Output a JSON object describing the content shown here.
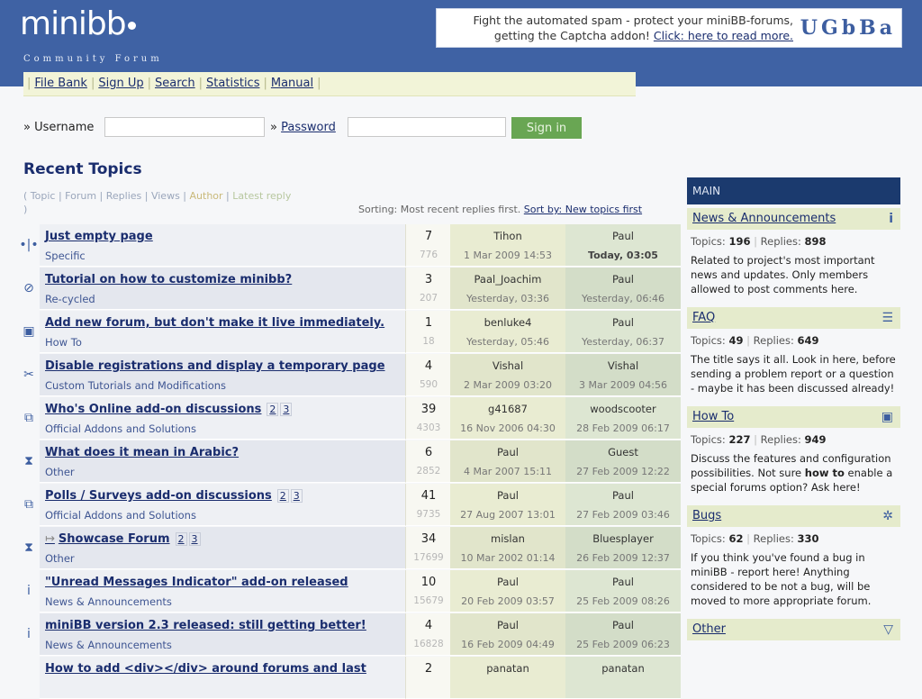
{
  "header": {
    "logo": "minibb",
    "logo_sub": "Community Forum",
    "ad_line1": "Fight the automated spam - protect your miniBB-forums,",
    "ad_line2": "getting the Captcha addon!",
    "ad_link": "Click: here to read more.",
    "ad_logo": "UGbBa"
  },
  "nav": [
    "File Bank",
    "Sign Up",
    "Search",
    "Statistics",
    "Manual"
  ],
  "login": {
    "username_label": "» Username",
    "password_label": "» Password",
    "signin": "Sign in"
  },
  "recent": {
    "title": "Recent Topics",
    "legend": [
      "Topic",
      "Forum",
      "Replies",
      "Views",
      "Author",
      "Latest reply"
    ],
    "sorting": "Sorting: Most recent replies first.",
    "sort_link": "Sort by: New topics first",
    "rows": [
      {
        "icon": "•|•",
        "title": "Just empty page",
        "forum": "Specific",
        "replies": "7",
        "views": "776",
        "author": "Tihon",
        "adate": "1 Mar 2009 14:53",
        "last": "Paul",
        "ldate": "Today, 03:05"
      },
      {
        "icon": "⊘",
        "title": "Tutorial on how to customize minibb?",
        "forum": "Re-cycled",
        "replies": "3",
        "views": "207",
        "author": "Paal_Joachim",
        "adate": "Yesterday, 03:36",
        "last": "Paul",
        "ldate": "Yesterday, 06:46"
      },
      {
        "icon": "▣",
        "title": "Add new forum, but don't make it live immediately.",
        "forum": "How To",
        "replies": "1",
        "views": "18",
        "author": "benluke4",
        "adate": "Yesterday, 05:46",
        "last": "Paul",
        "ldate": "Yesterday, 06:37"
      },
      {
        "icon": "✂",
        "title": "Disable registrations and display a temporary page",
        "forum": "Custom Tutorials and Modifications",
        "replies": "4",
        "views": "590",
        "author": "Vishal",
        "adate": "2 Mar 2009 03:20",
        "last": "Vishal",
        "ldate": "3 Mar 2009 04:56"
      },
      {
        "icon": "⧉",
        "title": "Who's Online add-on discussions",
        "pages": [
          "2",
          "3"
        ],
        "forum": "Official Addons and Solutions",
        "replies": "39",
        "views": "4303",
        "author": "g41687",
        "adate": "16 Nov 2006 04:30",
        "last": "woodscooter",
        "ldate": "28 Feb 2009 06:17"
      },
      {
        "icon": "⧗",
        "title": "What does it mean in Arabic?",
        "forum": "Other",
        "replies": "6",
        "views": "2852",
        "author": "Paul",
        "adate": "4 Mar 2007 15:11",
        "last": "Guest",
        "ldate": "27 Feb 2009 12:22"
      },
      {
        "icon": "⧉",
        "title": "Polls / Surveys add-on discussions",
        "pages": [
          "2",
          "3"
        ],
        "forum": "Official Addons and Solutions",
        "replies": "41",
        "views": "9735",
        "author": "Paul",
        "adate": "27 Aug 2007 13:01",
        "last": "Paul",
        "ldate": "27 Feb 2009 03:46"
      },
      {
        "icon": "⧗",
        "prefix": "↦",
        "title": "Showcase Forum",
        "pages": [
          "2",
          "3"
        ],
        "forum": "Other",
        "replies": "34",
        "views": "17699",
        "author": "mislan",
        "adate": "10 Mar 2002 01:14",
        "last": "Bluesplayer",
        "ldate": "26 Feb 2009 12:37"
      },
      {
        "icon": "i",
        "title": "\"Unread Messages Indicator\" add-on released",
        "forum": "News & Announcements",
        "replies": "10",
        "views": "15679",
        "author": "Paul",
        "adate": "20 Feb 2009 03:57",
        "last": "Paul",
        "ldate": "25 Feb 2009 08:26"
      },
      {
        "icon": "i",
        "title": "miniBB version 2.3 released: still getting better!",
        "forum": "News & Announcements",
        "replies": "4",
        "views": "16828",
        "author": "Paul",
        "adate": "16 Feb 2009 04:49",
        "last": "Paul",
        "ldate": "25 Feb 2009 06:23"
      },
      {
        "icon": "",
        "title": "How to add <div></div> around forums and last",
        "forum": "",
        "replies": "2",
        "views": "",
        "author": "panatan",
        "adate": "",
        "last": "panatan",
        "ldate": ""
      }
    ]
  },
  "sidebar": {
    "head": "MAIN",
    "topics_label": "Topics:",
    "replies_label": "Replies:",
    "forums": [
      {
        "name": "News & Announcements",
        "icon": "i",
        "topics": "196",
        "replies": "898",
        "desc": "Related to project's most important news and updates. Only members allowed to post comments here."
      },
      {
        "name": "FAQ",
        "icon": "☰",
        "topics": "49",
        "replies": "649",
        "desc": "The title says it all. Look in here, before sending a problem report or a question - maybe it has been discussed already!"
      },
      {
        "name": "How To",
        "icon": "▣",
        "topics": "227",
        "replies": "949",
        "desc_pre": "Discuss the features and configuration possibilities. Not sure ",
        "desc_bold": "how to",
        "desc_post": " enable a special forums option? Ask here!"
      },
      {
        "name": "Bugs",
        "icon": "✲",
        "topics": "62",
        "replies": "330",
        "desc": "If you think you've found a bug in miniBB - report here! Anything considered to be not a bug, will be moved to more appropriate forum."
      },
      {
        "name": "Other",
        "icon": "▽",
        "topics": "",
        "replies": "",
        "desc": ""
      }
    ]
  }
}
